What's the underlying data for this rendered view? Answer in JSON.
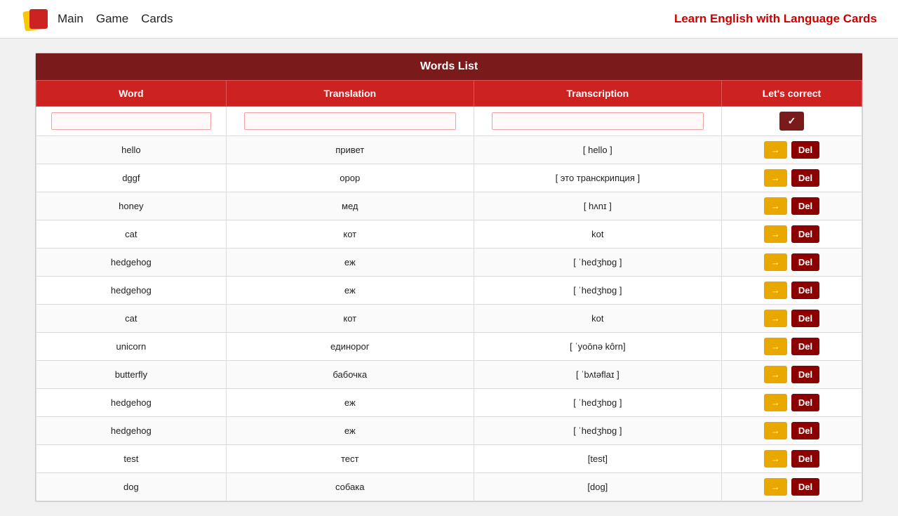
{
  "navbar": {
    "links": [
      "Main",
      "Game",
      "Cards"
    ],
    "tagline": "Learn English with ",
    "brand": "Language Cards"
  },
  "table": {
    "title": "Words List",
    "columns": [
      "Word",
      "Translation",
      "Transcription",
      "Let's correct"
    ],
    "input_row": {
      "word_placeholder": "",
      "translation_placeholder": "",
      "transcription_placeholder": "",
      "confirm_icon": "✓"
    },
    "rows": [
      {
        "word": "hello",
        "translation": "привет",
        "transcription": "[ hello ]",
        "edit": "→",
        "del": "Del"
      },
      {
        "word": "dggf",
        "translation": "opop",
        "transcription": "[ это транскрипция ]",
        "edit": "→",
        "del": "Del"
      },
      {
        "word": "honey",
        "translation": "мед",
        "transcription": "[ hʌnɪ ]",
        "edit": "→",
        "del": "Del"
      },
      {
        "word": "cat",
        "translation": "кот",
        "transcription": "kot",
        "edit": "→",
        "del": "Del"
      },
      {
        "word": "hedgehog",
        "translation": "еж",
        "transcription": "[ ˈhedʒhɒɡ ]",
        "edit": "→",
        "del": "Del"
      },
      {
        "word": "hedgehog",
        "translation": "еж",
        "transcription": "[ ˈhedʒhɒɡ ]",
        "edit": "→",
        "del": "Del"
      },
      {
        "word": "cat",
        "translation": "кот",
        "transcription": "kot",
        "edit": "→",
        "del": "Del"
      },
      {
        "word": "unicorn",
        "translation": "единорог",
        "transcription": "[ ˈyoōnə kôrn]",
        "edit": "→",
        "del": "Del"
      },
      {
        "word": "butterfly",
        "translation": "бабочка",
        "transcription": "[ ˈbʌtəflaɪ ]",
        "edit": "→",
        "del": "Del"
      },
      {
        "word": "hedgehog",
        "translation": "еж",
        "transcription": "[ ˈhedʒhɒɡ ]",
        "edit": "→",
        "del": "Del"
      },
      {
        "word": "hedgehog",
        "translation": "еж",
        "transcription": "[ ˈhedʒhɒɡ ]",
        "edit": "→",
        "del": "Del"
      },
      {
        "word": "test",
        "translation": "тест",
        "transcription": "[test]",
        "edit": "→",
        "del": "Del"
      },
      {
        "word": "dog",
        "translation": "собака",
        "transcription": "[dog]",
        "edit": "→",
        "del": "Del"
      }
    ]
  }
}
